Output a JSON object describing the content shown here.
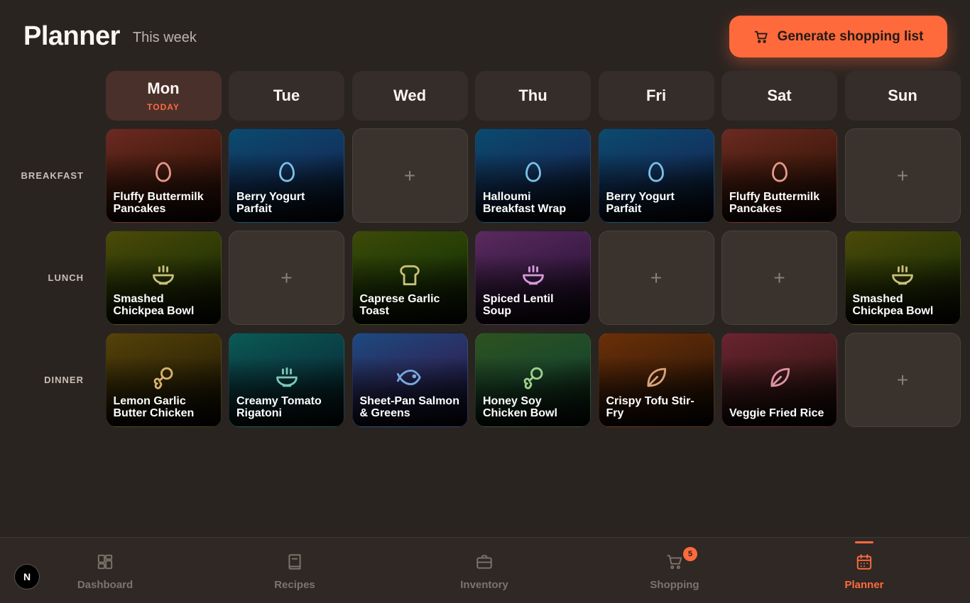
{
  "header": {
    "title": "Planner",
    "subtitle": "This week",
    "generate_label": "Generate shopping list"
  },
  "days": [
    {
      "name": "Mon",
      "badge": "TODAY"
    },
    {
      "name": "Tue",
      "badge": ""
    },
    {
      "name": "Wed",
      "badge": ""
    },
    {
      "name": "Thu",
      "badge": ""
    },
    {
      "name": "Fri",
      "badge": ""
    },
    {
      "name": "Sat",
      "badge": ""
    },
    {
      "name": "Sun",
      "badge": ""
    }
  ],
  "meal_types": [
    "BREAKFAST",
    "LUNCH",
    "DINNER"
  ],
  "empty_slot_glyph": "+",
  "meals": {
    "breakfast": [
      {
        "name": "Fluffy Buttermilk Pancakes",
        "icon": "egg-icon",
        "theme": "rust",
        "icon_color": "#e39a8a"
      },
      {
        "name": "Berry Yogurt Parfait",
        "icon": "egg-icon",
        "theme": "blue",
        "icon_color": "#7cc0e6"
      },
      null,
      {
        "name": "Halloumi Breakfast Wrap",
        "icon": "egg-icon",
        "theme": "blue",
        "icon_color": "#7cc0e6"
      },
      {
        "name": "Berry Yogurt Parfait",
        "icon": "egg-icon",
        "theme": "blue",
        "icon_color": "#7cc0e6"
      },
      {
        "name": "Fluffy Buttermilk Pancakes",
        "icon": "egg-icon",
        "theme": "rust",
        "icon_color": "#e39a8a"
      },
      null
    ],
    "lunch": [
      {
        "name": "Smashed Chickpea Bowl",
        "icon": "bowl-icon",
        "theme": "olive",
        "icon_color": "#c9c07a"
      },
      null,
      {
        "name": "Caprese Garlic Toast",
        "icon": "toast-icon",
        "theme": "green",
        "icon_color": "#c9c07a"
      },
      {
        "name": "Spiced Lentil Soup",
        "icon": "bowl-icon",
        "theme": "purple",
        "icon_color": "#d49ad8"
      },
      null,
      null,
      {
        "name": "Smashed Chickpea Bowl",
        "icon": "bowl-icon",
        "theme": "olive",
        "icon_color": "#c9c07a"
      }
    ],
    "dinner": [
      {
        "name": "Lemon Garlic Butter Chicken",
        "icon": "drumstick-icon",
        "theme": "ochre",
        "icon_color": "#d6b36a"
      },
      {
        "name": "Creamy Tomato Rigatoni",
        "icon": "bowl-icon",
        "theme": "teal",
        "icon_color": "#7cc7b8"
      },
      {
        "name": "Sheet-Pan Salmon & Greens",
        "icon": "fish-icon",
        "theme": "navy",
        "icon_color": "#7aa8de"
      },
      {
        "name": "Honey Soy Chicken Bowl",
        "icon": "drumstick-icon",
        "theme": "forest",
        "icon_color": "#9fd08c"
      },
      {
        "name": "Crispy Tofu Stir-Fry",
        "icon": "leaf-icon",
        "theme": "orange",
        "icon_color": "#d9a27a"
      },
      {
        "name": "Veggie Fried Rice",
        "icon": "leaf-icon",
        "theme": "wine",
        "icon_color": "#dd95a3"
      },
      null
    ]
  },
  "nav": [
    {
      "label": "Dashboard",
      "icon": "dashboard-icon",
      "active": false
    },
    {
      "label": "Recipes",
      "icon": "book-icon",
      "active": false
    },
    {
      "label": "Inventory",
      "icon": "briefcase-icon",
      "active": false
    },
    {
      "label": "Shopping",
      "icon": "cart-icon",
      "active": false,
      "badge": "5"
    },
    {
      "label": "Planner",
      "icon": "calendar-icon",
      "active": true
    }
  ],
  "colors": {
    "accent": "#ff6a3d",
    "background": "#2a2421",
    "muted": "#7d736b"
  },
  "dev_badge": "N"
}
